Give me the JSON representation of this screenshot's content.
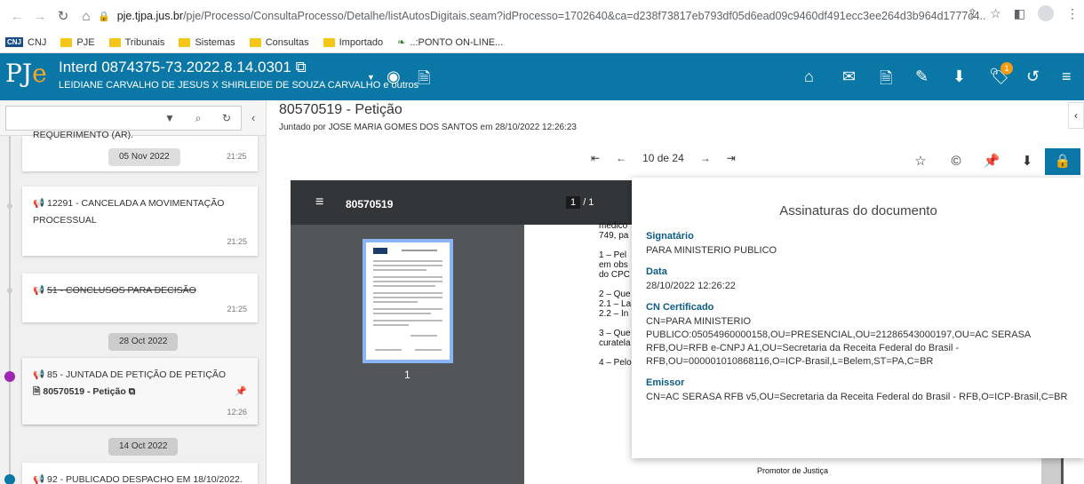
{
  "browser": {
    "url_host": "pje.tjpa.jus.br",
    "url_path": "/pje/Processo/ConsultaProcesso/Detalhe/listAutosDigitais.seam?idProcesso=1702640&ca=d238f73817eb793df05d6ead09c9460df491ecc3ee264d3b964d1777c4..."
  },
  "bookmarks": [
    "CNJ",
    "PJE",
    "Tribunais",
    "Sistemas",
    "Consultas",
    "Importado",
    "..:PONTO ON-LINE..."
  ],
  "header": {
    "logo_left": "PJ",
    "logo_right": "e",
    "process_title": "Interd 0874375-73.2022.8.14.0301",
    "process_parties": "LEIDIANE CARVALHO DE JESUS X SHIRLEIDE DE SOUZA CARVALHO e outros",
    "notification_count": "1"
  },
  "timeline": {
    "items": [
      {
        "type": "card_partial",
        "text": "REQUERIMENTO (AR).",
        "date_pill": "05 Nov 2022",
        "time": "21:25"
      },
      {
        "type": "card",
        "text": "12291 - CANCELADA A MOVIMENTAÇÃO PROCESSUAL",
        "time": "21:25"
      },
      {
        "type": "card",
        "text": "51 - CONCLUSOS PARA DECISÃO",
        "time": "21:25"
      },
      {
        "type": "date",
        "text": "28 Oct 2022"
      },
      {
        "type": "card",
        "text": "85 - JUNTADA DE PETIÇÃO DE PETIÇÃO",
        "doc": "80570519 - Petição",
        "time": "12:26"
      },
      {
        "type": "date",
        "text": "14 Oct 2022"
      },
      {
        "type": "card",
        "text": "92 - PUBLICADO DESPACHO EM 18/10/2022."
      }
    ]
  },
  "document": {
    "title": "80570519 - Petição",
    "subtitle": "Juntado por JOSE MARIA GOMES DOS SANTOS em 28/10/2022 12:26:23",
    "pager": "10 de 24",
    "viewer_name": "80570519",
    "viewer_page_current": "1",
    "viewer_page_total": "/ 1",
    "thumb_number": "1",
    "page_lines": [
      "médico",
      "749, pa",
      "1 – Pel",
      "em obs",
      "do CPC",
      "2 – Que",
      "2.1 – La",
      "2.2 – In",
      "3 – Que",
      "curatela",
      "4 – Pelo"
    ],
    "page_footer": "Promotor de Justiça"
  },
  "signatures": {
    "title": "Assinaturas do documento",
    "signatario_label": "Signatário",
    "signatario": "PARA MINISTERIO PUBLICO",
    "data_label": "Data",
    "data": "28/10/2022 12:26:22",
    "cn_label": "CN Certificado",
    "cn": "CN=PARA MINISTERIO PUBLICO:05054960000158,OU=PRESENCIAL,OU=21286543000197,OU=AC SERASA RFB,OU=RFB e-CNPJ A1,OU=Secretaria da Receita Federal do Brasil - RFB,OU=000001010868116,O=ICP-Brasil,L=Belem,ST=PA,C=BR",
    "emissor_label": "Emissor",
    "emissor": "CN=AC SERASA RFB v5,OU=Secretaria da Receita Federal do Brasil - RFB,O=ICP-Brasil,C=BR"
  }
}
